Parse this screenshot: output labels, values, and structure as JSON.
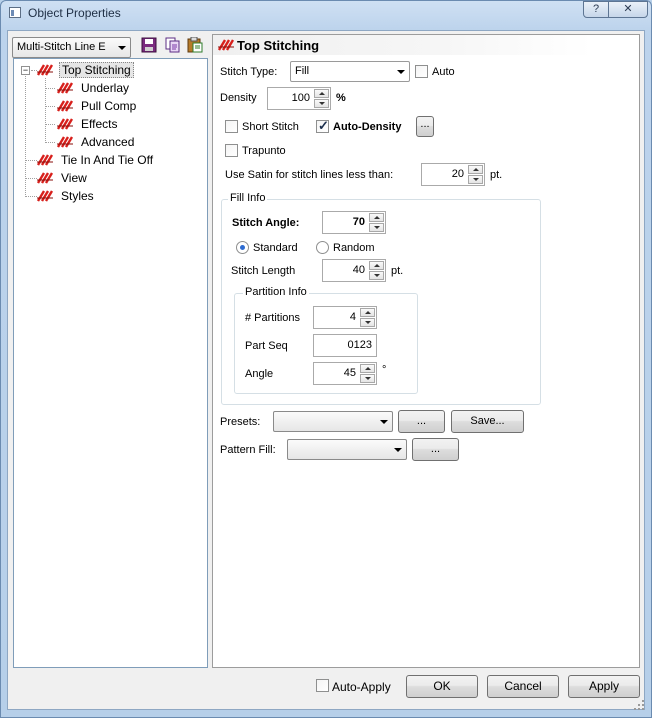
{
  "window": {
    "title": "Object Properties",
    "help_label": "?",
    "close_label": "✕"
  },
  "toolbar": {
    "object_type": "Multi-Stitch Line E"
  },
  "tree": {
    "items": [
      {
        "label": "Top Stitching"
      },
      {
        "label": "Underlay"
      },
      {
        "label": "Pull Comp"
      },
      {
        "label": "Effects"
      },
      {
        "label": "Advanced"
      },
      {
        "label": "Tie In And Tie Off"
      },
      {
        "label": "View"
      },
      {
        "label": "Styles"
      }
    ]
  },
  "panel": {
    "title": "Top Stitching",
    "stitch_type_label": "Stitch Type:",
    "stitch_type_value": "Fill",
    "auto_label": "Auto",
    "density_label": "Density",
    "density_value": "100",
    "density_unit": "%",
    "short_stitch_label": "Short Stitch",
    "auto_density_label": "Auto-Density",
    "ellipsis": "...",
    "trapunto_label": "Trapunto",
    "satin_label": "Use Satin for stitch lines less than:",
    "satin_value": "20",
    "pt": "pt.",
    "fill_info": {
      "caption": "Fill Info",
      "angle_label": "Stitch Angle:",
      "angle_value": "70",
      "standard_label": "Standard",
      "random_label": "Random",
      "length_label": "Stitch Length",
      "length_value": "40"
    },
    "partition_info": {
      "caption": "Partition Info",
      "partitions_label": "# Partitions",
      "partitions_value": "4",
      "part_seq_label": "Part Seq",
      "part_seq_value": "0123",
      "angle_label": "Angle",
      "angle_value": "45",
      "degree": "°"
    },
    "presets_label": "Presets:",
    "save_label": "Save...",
    "pattern_fill_label": "Pattern Fill:"
  },
  "footer": {
    "auto_apply_label": "Auto-Apply",
    "ok_label": "OK",
    "cancel_label": "Cancel",
    "apply_label": "Apply"
  },
  "state": {
    "auto_checked": false,
    "short_stitch_checked": false,
    "auto_density_checked": true,
    "trapunto_checked": false,
    "standard_selected": true,
    "auto_apply_checked": false,
    "selected_tree_item": "Top Stitching"
  },
  "colors": {
    "stitch_icon": "#d8201c",
    "accent": "#2d6bd1"
  }
}
